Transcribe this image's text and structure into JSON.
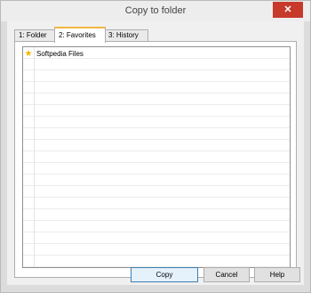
{
  "window": {
    "title": "Copy to folder",
    "close_glyph": "✕"
  },
  "tabs": [
    {
      "label": "1: Folder"
    },
    {
      "label": "2: Favorites",
      "active": true
    },
    {
      "label": "3: History"
    }
  ],
  "favorites": {
    "items": [
      {
        "label": "Softpedia Files",
        "icon": "star-icon"
      }
    ]
  },
  "buttons": {
    "copy": "Copy",
    "cancel": "Cancel",
    "help": "Help"
  }
}
